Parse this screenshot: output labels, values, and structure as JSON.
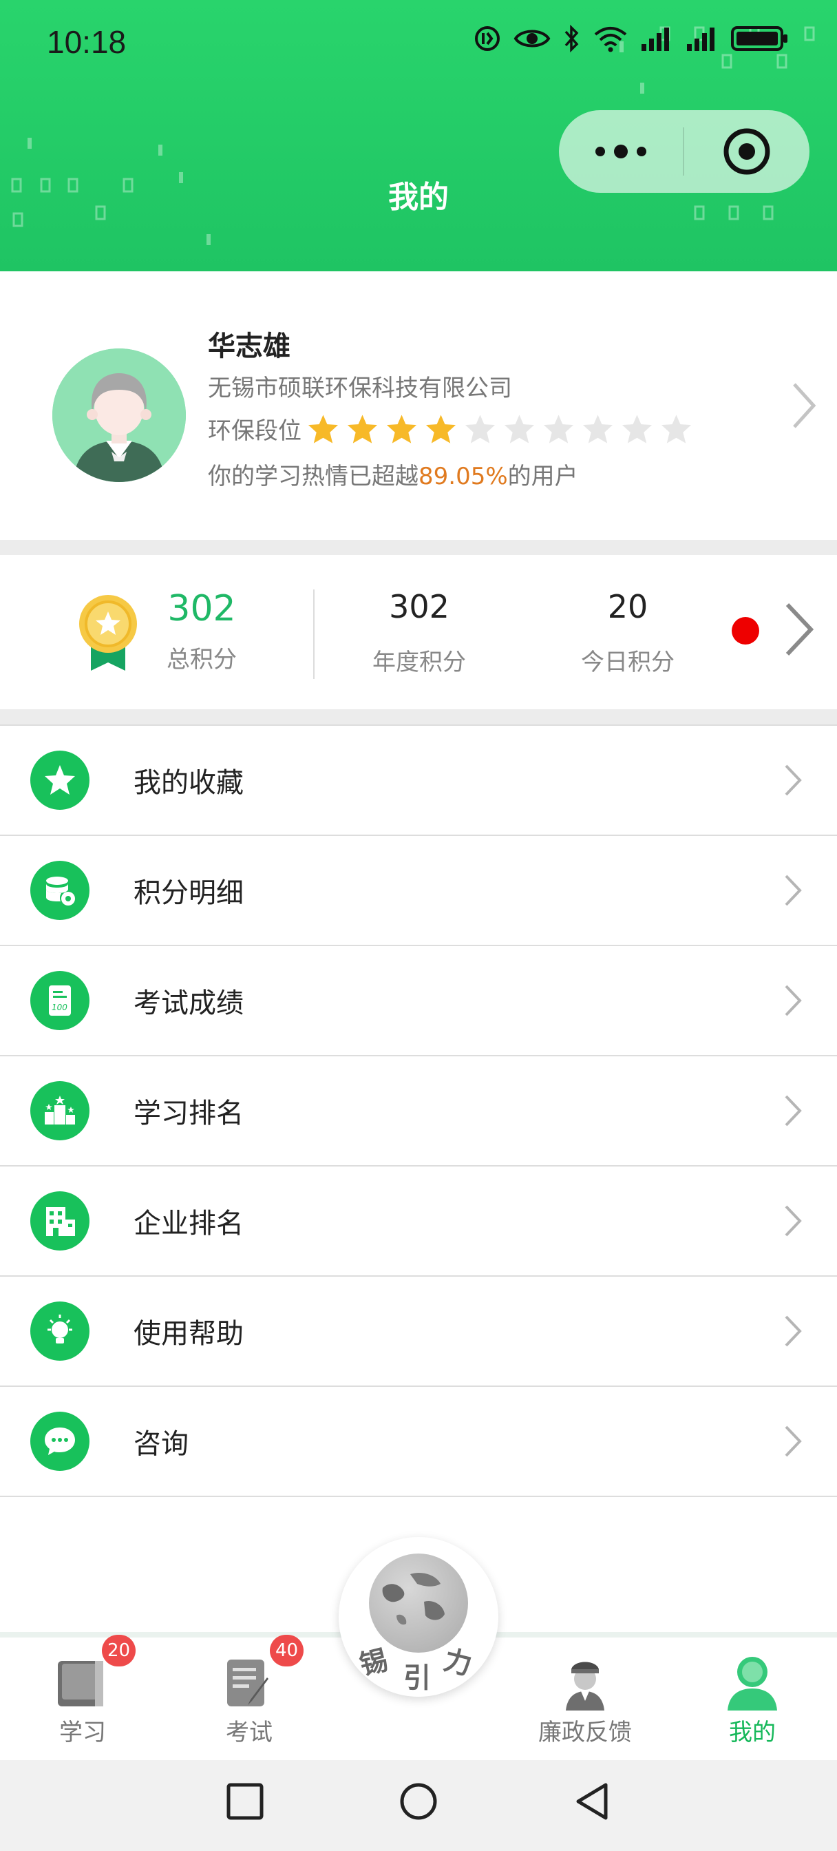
{
  "status_bar": {
    "time": "10:18"
  },
  "header": {
    "title": "我的"
  },
  "profile": {
    "name": "华志雄",
    "company": "无锡市硕联环保科技有限公司",
    "level_label": "环保段位",
    "stars_filled": 4,
    "stars_total": 10,
    "exceed_prefix": "你的学习热情已超越",
    "exceed_percent": "89.05%",
    "exceed_suffix": "的用户"
  },
  "points": {
    "total": {
      "value": "302",
      "label": "总积分"
    },
    "annual": {
      "value": "302",
      "label": "年度积分"
    },
    "today": {
      "value": "20",
      "label": "今日积分"
    }
  },
  "menu": [
    {
      "label": "我的收藏",
      "icon": "star-icon"
    },
    {
      "label": "积分明细",
      "icon": "coins-icon"
    },
    {
      "label": "考试成绩",
      "icon": "exam-score-icon"
    },
    {
      "label": "学习排名",
      "icon": "ranking-icon"
    },
    {
      "label": "企业排名",
      "icon": "building-icon"
    },
    {
      "label": "使用帮助",
      "icon": "lightbulb-icon"
    },
    {
      "label": "咨询",
      "icon": "chat-icon"
    }
  ],
  "tabbar": {
    "study": {
      "label": "学习",
      "badge": "20"
    },
    "exam": {
      "label": "考试",
      "badge": "40"
    },
    "center": {
      "chars": [
        "锡",
        "引",
        "力"
      ]
    },
    "feedback": {
      "label": "廉政反馈"
    },
    "mine": {
      "label": "我的"
    }
  },
  "colors": {
    "brand_green": "#1fc463",
    "accent_orange": "#e07a1f",
    "badge_red": "#ee4a4a",
    "star_gold": "#f7b928"
  }
}
